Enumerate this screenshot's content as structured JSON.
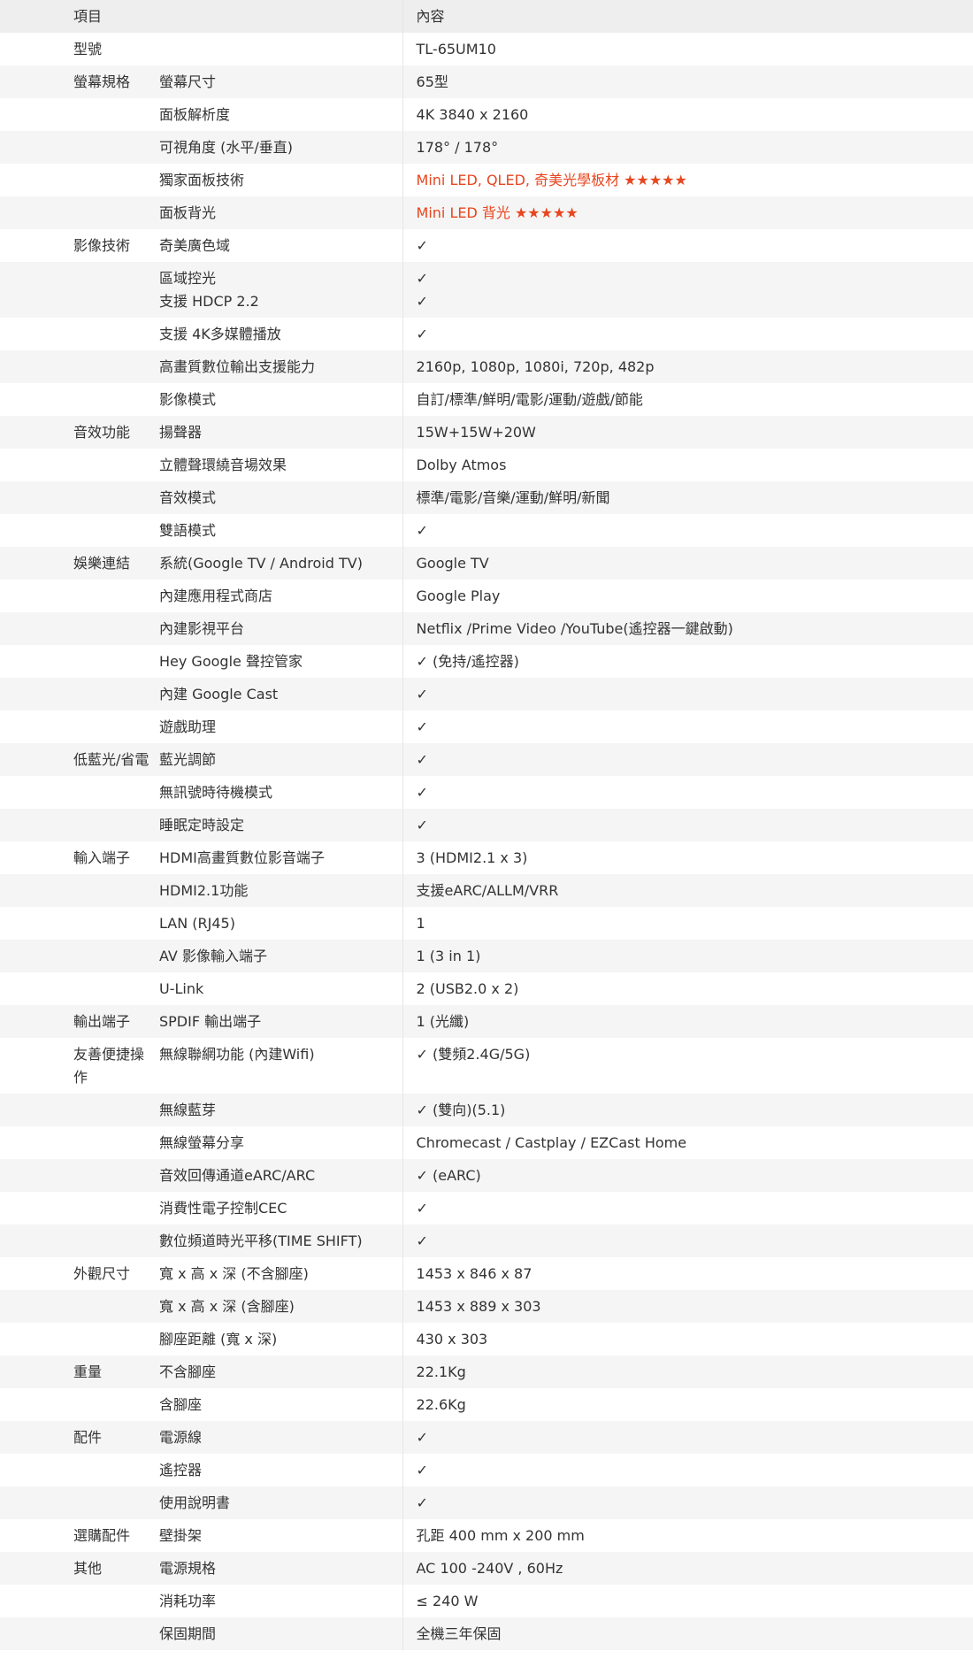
{
  "header": {
    "col1": "項目",
    "col2": "內容"
  },
  "rows": [
    {
      "cat": "型號",
      "item": "",
      "value": "TL-65UM10"
    },
    {
      "cat": "螢幕規格",
      "item": "螢幕尺寸",
      "value": "65型"
    },
    {
      "cat": "",
      "item": "面板解析度",
      "value": "4K 3840 x 2160"
    },
    {
      "cat": "",
      "item": "可視角度 (水平/垂直)",
      "value": "178° / 178°"
    },
    {
      "cat": "",
      "item": "獨家面板技術",
      "value": "Mini LED, QLED, 奇美光學板材 ★★★★★",
      "highlight": true
    },
    {
      "cat": "",
      "item": "面板背光",
      "value": "Mini LED 背光 ★★★★★",
      "highlight": true
    },
    {
      "cat": "影像技術",
      "item": "奇美廣色域",
      "value": "✓"
    },
    {
      "cat": "",
      "item": "區域控光\n支援 HDCP 2.2",
      "value": "✓\n✓",
      "tall": true
    },
    {
      "cat": "",
      "item": "支援 4K多媒體播放",
      "value": "✓"
    },
    {
      "cat": "",
      "item": "高畫質數位輸出支援能力",
      "value": "2160p, 1080p, 1080i, 720p, 482p"
    },
    {
      "cat": "",
      "item": "影像模式",
      "value": "自訂/標準/鮮明/電影/運動/遊戲/節能"
    },
    {
      "cat": "音效功能",
      "item": "揚聲器",
      "value": "15W+15W+20W"
    },
    {
      "cat": "",
      "item": "立體聲環繞音場效果",
      "value": "Dolby Atmos"
    },
    {
      "cat": "",
      "item": "音效模式",
      "value": "標準/電影/音樂/運動/鮮明/新聞"
    },
    {
      "cat": "",
      "item": "雙語模式",
      "value": "✓"
    },
    {
      "cat": "娛樂連結",
      "item": "系統(Google TV / Android TV)",
      "value": "Google TV"
    },
    {
      "cat": "",
      "item": "內建應用程式商店",
      "value": "Google Play"
    },
    {
      "cat": "",
      "item": "內建影視平台",
      "value": "Netflix /Prime Video /YouTube(遙控器一鍵啟動)"
    },
    {
      "cat": "",
      "item": "Hey Google 聲控管家",
      "value": "✓ (免持/遙控器)"
    },
    {
      "cat": "",
      "item": "內建 Google Cast",
      "value": "✓"
    },
    {
      "cat": "",
      "item": "遊戲助理",
      "value": "✓"
    },
    {
      "cat": "低藍光/省電",
      "item": "藍光調節",
      "value": "✓"
    },
    {
      "cat": "",
      "item": "無訊號時待機模式",
      "value": "✓"
    },
    {
      "cat": "",
      "item": "睡眠定時設定",
      "value": "✓"
    },
    {
      "cat": "輸入端子",
      "item": "HDMI高畫質數位影音端子",
      "value": "3 (HDMI2.1 x 3)"
    },
    {
      "cat": "",
      "item": "HDMI2.1功能",
      "value": "支援eARC/ALLM/VRR"
    },
    {
      "cat": "",
      "item": "LAN (RJ45)",
      "value": "1"
    },
    {
      "cat": "",
      "item": "AV 影像輸入端子",
      "value": "1 (3 in 1)"
    },
    {
      "cat": "",
      "item": "U-Link",
      "value": "2 (USB2.0 x 2)"
    },
    {
      "cat": "輸出端子",
      "item": "SPDIF 輸出端子",
      "value": "1 (光纖)"
    },
    {
      "cat": "友善便捷操作",
      "item": "無線聯網功能 (內建Wifi)",
      "value": "✓ (雙頻2.4G/5G)",
      "tall": true
    },
    {
      "cat": "",
      "item": "無線藍芽",
      "value": "✓ (雙向)(5.1)"
    },
    {
      "cat": "",
      "item": "無線螢幕分享",
      "value": "Chromecast / Castplay / EZCast Home"
    },
    {
      "cat": "",
      "item": "音效回傳通道eARC/ARC",
      "value": "✓ (eARC)"
    },
    {
      "cat": "",
      "item": "消費性電子控制CEC",
      "value": "✓"
    },
    {
      "cat": "",
      "item": "數位頻道時光平移(TIME SHIFT)",
      "value": "✓"
    },
    {
      "cat": "外觀尺寸",
      "item": "寬 x 高 x 深 (不含腳座)",
      "value": "1453 x 846 x 87"
    },
    {
      "cat": "",
      "item": "寬 x 高 x 深 (含腳座)",
      "value": "1453 x 889 x 303"
    },
    {
      "cat": "",
      "item": "腳座距離 (寬 x 深)",
      "value": "430 x 303"
    },
    {
      "cat": "重量",
      "item": "不含腳座",
      "value": "22.1Kg"
    },
    {
      "cat": "",
      "item": "含腳座",
      "value": "22.6Kg"
    },
    {
      "cat": "配件",
      "item": "電源線",
      "value": "✓"
    },
    {
      "cat": "",
      "item": "遙控器",
      "value": "✓"
    },
    {
      "cat": "",
      "item": "使用說明書",
      "value": "✓"
    },
    {
      "cat": "選購配件",
      "item": "壁掛架",
      "value": "孔距 400 mm x 200 mm"
    },
    {
      "cat": "其他",
      "item": "電源規格",
      "value": "AC 100 -240V , 60Hz"
    },
    {
      "cat": "",
      "item": "消耗功率",
      "value": "≤ 240 W"
    },
    {
      "cat": "",
      "item": "保固期間",
      "value": "全機三年保固"
    }
  ],
  "colors": {
    "highlight": "#e8461f",
    "stripe": "#f5f5f5",
    "header_bg": "#eeeeee"
  }
}
